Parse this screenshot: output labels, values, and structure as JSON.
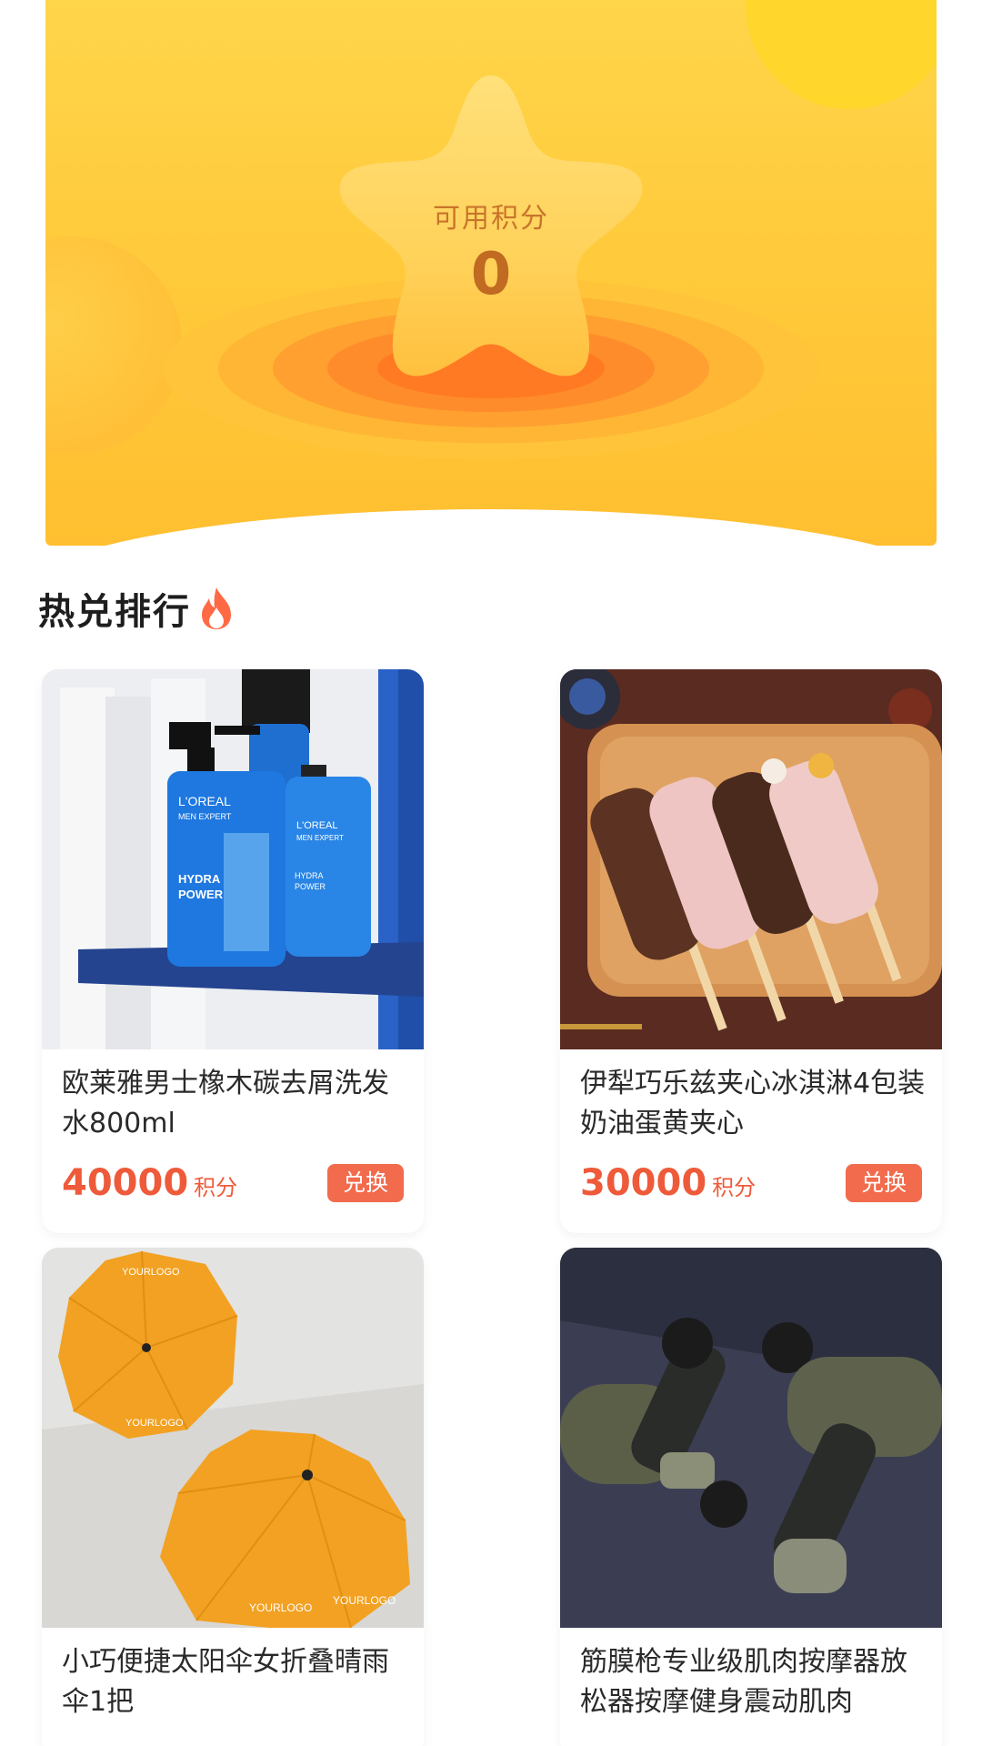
{
  "points": {
    "label": "可用积分",
    "value": "0"
  },
  "section": {
    "title": "热兑排行",
    "icon": "fire-icon"
  },
  "products": [
    {
      "title": "欧莱雅男士橡木碳去屑洗发水800ml",
      "price": "40000",
      "unit": "积分",
      "button": "兑换"
    },
    {
      "title": "伊犁巧乐兹夹心冰淇淋4包装奶油蛋黄夹心",
      "price": "30000",
      "unit": "积分",
      "button": "兑换"
    },
    {
      "title": "小巧便捷太阳伞女折叠晴雨伞1把",
      "price": "",
      "unit": "",
      "button": ""
    },
    {
      "title": "筋膜枪专业级肌肉按摩器放松器按摩健身震动肌肉",
      "price": "",
      "unit": "",
      "button": ""
    }
  ],
  "umbrella_logo_text": "YOURLOGO",
  "colors": {
    "hero_yellow": "#ffcb3c",
    "accent_orange": "#ee5a3a",
    "button_bg": "#f26b4d"
  }
}
